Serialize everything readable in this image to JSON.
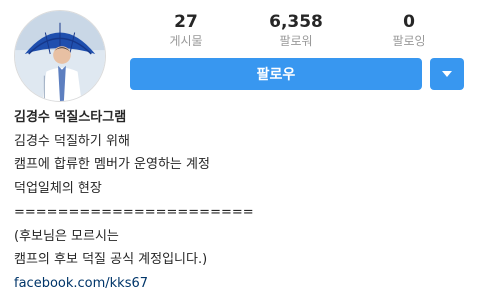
{
  "profile": {
    "stats": [
      {
        "value": "27",
        "label": "게시물"
      },
      {
        "value": "6,358",
        "label": "팔로워"
      },
      {
        "value": "0",
        "label": "팔로잉"
      }
    ],
    "follow_label": "팔로우",
    "dropdown_icon": "chevron-down-icon",
    "accent_color": "#3897f0"
  },
  "bio": {
    "name": "김경수 덕질스타그램",
    "lines": [
      "김경수 덕질하기 위해",
      "캠프에 합류한 멤버가 운영하는 계정",
      "덕업일체의 현장",
      "======================",
      "(후보님은 모르시는",
      "캠프의 후보 덕질 공식 계정입니다.)"
    ],
    "link": "facebook.com/kks67"
  }
}
